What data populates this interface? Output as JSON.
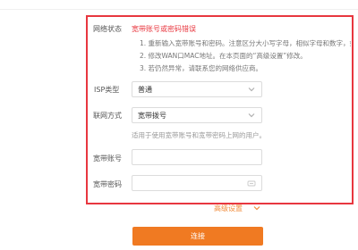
{
  "status": {
    "label": "网络状态",
    "message": "宽带账号或密码错误",
    "tips": [
      "1. 重新输入宽带账号和密码。注意区分大小写字母，相似字母和数字，如l和1、",
      "2. 修改WAN口MAC地址。在本页面的“高级设置”修改。",
      "3. 若仍然异常，请联系您的网络供应商。"
    ]
  },
  "isp": {
    "label": "ISP类型",
    "value": "普通"
  },
  "connection": {
    "label": "联网方式",
    "value": "宽带拨号",
    "hint": "适用于使用宽带账号和宽带密码上网的用户。"
  },
  "account": {
    "label": "宽带账号",
    "value": ""
  },
  "password": {
    "label": "宽带密码",
    "value": ""
  },
  "advanced": {
    "label": "高级设置"
  },
  "connect_button": {
    "label": "连接"
  },
  "colors": {
    "error": "#e8373f",
    "accent": "#f07a22"
  }
}
